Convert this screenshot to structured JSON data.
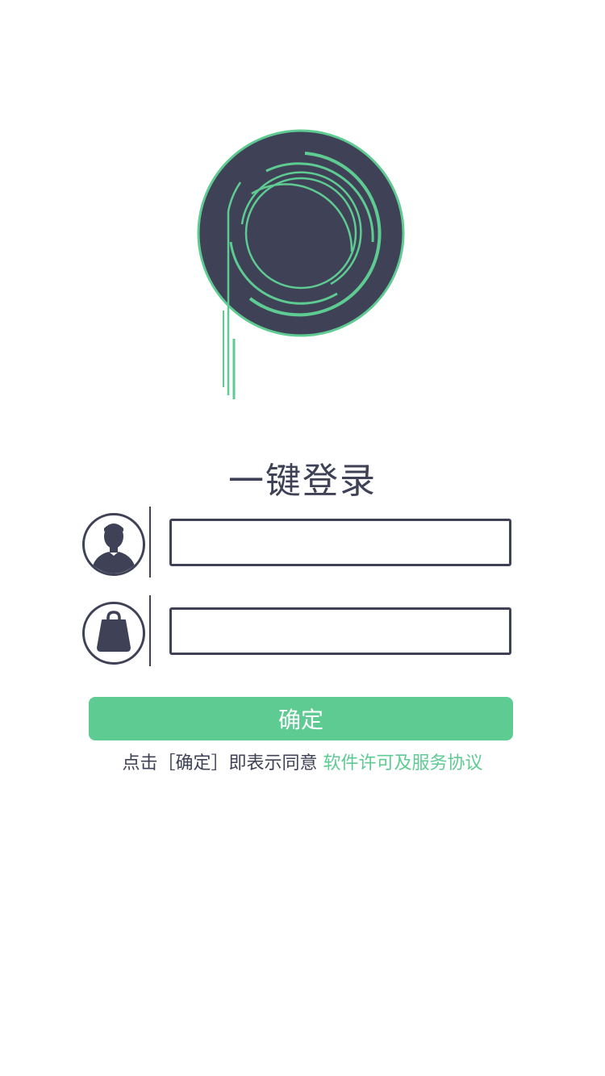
{
  "colors": {
    "brand": "#5ecb92",
    "dark": "#3f4256",
    "background": "#ffffff"
  },
  "logo": {
    "icon": "app-logo"
  },
  "login": {
    "title": "一键登录",
    "username_field": {
      "icon": "user-avatar-icon",
      "value": "",
      "placeholder": ""
    },
    "password_field": {
      "icon": "bag-lock-icon",
      "value": "",
      "placeholder": ""
    },
    "confirm_label": "确定",
    "agreement_prefix": "点击［确定］即表示同意",
    "agreement_link": "软件许可及服务协议"
  }
}
